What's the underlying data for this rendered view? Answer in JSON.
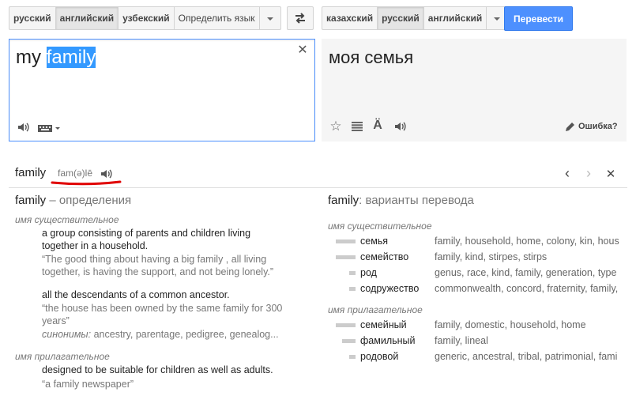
{
  "source_langs": [
    "русский",
    "английский",
    "узбекский",
    "Определить язык"
  ],
  "target_langs": [
    "казахский",
    "русский",
    "английский"
  ],
  "translate_button": "Перевести",
  "source": {
    "before": "my ",
    "selected": "family"
  },
  "target": {
    "text": "моя семья",
    "report": "Ошибка?"
  },
  "headword": "family",
  "phonetic": "fam(ə)lē",
  "definitions": {
    "header_word": "family",
    "header_rest": " – определения",
    "pos_noun": "имя существительное",
    "def1": [
      "a group consisting of parents and children living",
      "together in a household."
    ],
    "ex1": [
      "“The good thing about having a big family , all living",
      "together, is having the support, and not being lonely.”"
    ],
    "def2": [
      "all the descendants of a common ancestor."
    ],
    "ex2": [
      "“the house has been owned by the same family for 300",
      "years”"
    ],
    "synonyms": {
      "label": "синонимы:",
      "text": " ancestry, parentage, pedigree, genealog..."
    },
    "pos_adj": "имя прилагательное",
    "def3": [
      "designed to be suitable for children as well as adults."
    ],
    "ex3": [
      "“a family newspaper”"
    ]
  },
  "translations": {
    "header_word": "family",
    "header_rest": ": варианты перевода",
    "pos_noun": "имя существительное",
    "noun_rows": [
      {
        "word": "семья",
        "alts": "family, household, home, colony, kin, hous",
        "freq": 3
      },
      {
        "word": "семейство",
        "alts": "family, kind, stirpes, stirps",
        "freq": 3
      },
      {
        "word": "род",
        "alts": "genus, race, kind, family, generation, type",
        "freq": 1
      },
      {
        "word": "содружество",
        "alts": "commonwealth, concord, fraternity, family,",
        "freq": 1
      }
    ],
    "pos_adj": "имя прилагательное",
    "adj_rows": [
      {
        "word": "семейный",
        "alts": "family, domestic, household, home",
        "freq": 3
      },
      {
        "word": "фамильный",
        "alts": "family, lineal",
        "freq": 2
      },
      {
        "word": "родовой",
        "alts": "generic, ancestral, tribal, patrimonial, fami",
        "freq": 1
      }
    ]
  },
  "colors": {
    "accent": "#4d90fe",
    "selection": "#3399ff",
    "underline": "#e00000",
    "bar": "#cccccc"
  }
}
